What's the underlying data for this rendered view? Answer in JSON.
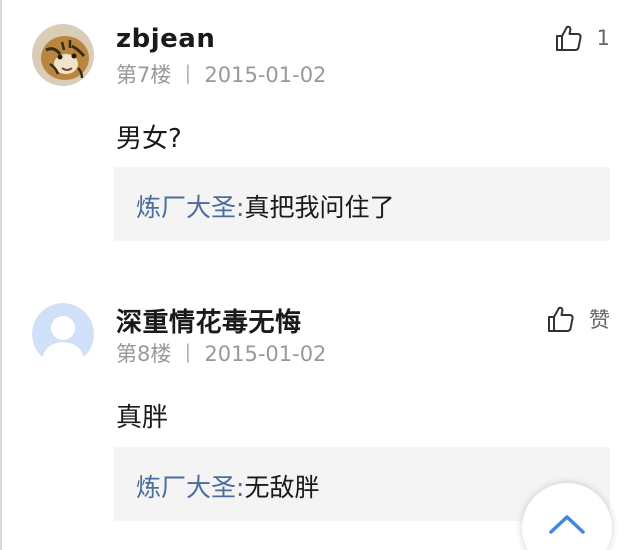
{
  "comments": [
    {
      "username": "zbjean",
      "floor": "第7楼",
      "separator": "丨",
      "date": "2015-01-02",
      "like_icon": "thumbs-up-icon",
      "like_text": "1",
      "content": "男女?",
      "reply": {
        "author": "炼厂大圣:",
        "text": "真把我问住了"
      },
      "avatar": "tiger-avatar"
    },
    {
      "username": "深重情花毒无悔",
      "floor": "第8楼",
      "separator": "丨",
      "date": "2015-01-02",
      "like_icon": "thumbs-up-icon",
      "like_text": "赞",
      "content": "真胖",
      "reply": {
        "author": "炼厂大圣:",
        "text": "无敌胖"
      },
      "avatar": "default-user-avatar"
    }
  ],
  "scroll_top_icon": "chevron-up-icon",
  "colors": {
    "reply_author": "#4a6d9c",
    "meta_text": "#999999",
    "reply_background": "#f4f4f4",
    "accent": "#3f87e0"
  }
}
